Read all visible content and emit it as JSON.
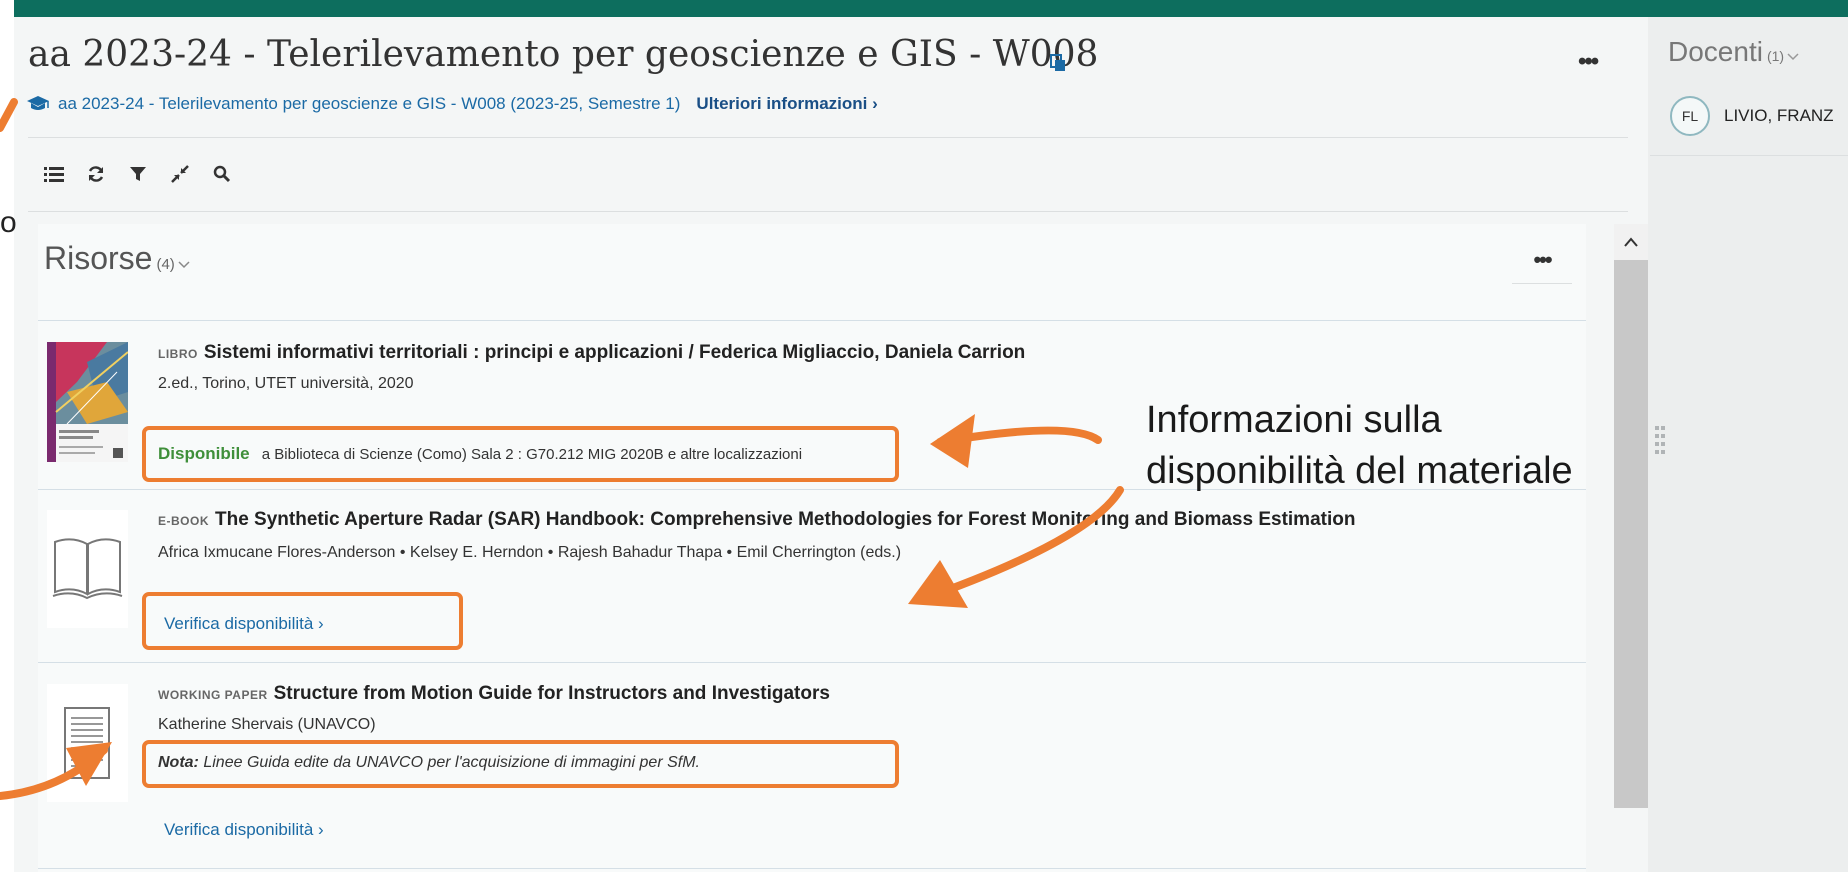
{
  "header": {
    "title": "aa 2023-24 - Telerilevamento per geoscienze e GIS - W008",
    "course_link": "aa 2023-24 - Telerilevamento per geoscienze e GIS - W008 (2023-25, Semestre 1)",
    "more_info": "Ulteriori informazioni ›",
    "more_menu": "•••"
  },
  "toolbar": {
    "icons": [
      "list-icon",
      "refresh-icon",
      "filter-icon",
      "collapse-icon",
      "search-icon"
    ]
  },
  "resources": {
    "heading": "Risorse",
    "count": "(4)",
    "more_menu": "•••",
    "items": [
      {
        "type": "LIBRO",
        "title": "Sistemi informativi territoriali : principi e applicazioni / Federica Migliaccio, Daniela Carrion",
        "subtitle": "2.ed., Torino, UTET università, 2020",
        "availability_status": "Disponibile",
        "availability_location": "a Biblioteca di Scienze (Como) Sala 2 : G70.212 MIG 2020B e altre localizzazioni"
      },
      {
        "type": "E-BOOK",
        "title": "The Synthetic Aperture Radar (SAR) Handbook: Comprehensive Methodologies for Forest Monitoring and Biomass Estimation",
        "subtitle": "Africa Ixmucane Flores-Anderson • Kelsey E. Herndon • Rajesh Bahadur Thapa • Emil Cherrington (eds.)",
        "verify": "Verifica disponibilità ›"
      },
      {
        "type": "WORKING PAPER",
        "title": "Structure from Motion Guide for Instructors and Investigators",
        "subtitle": "Katherine Shervais (UNAVCO)",
        "note_label": "Nota:",
        "note_text": "Linee Guida edite da UNAVCO per l'acquisizione di immagini per SfM.",
        "verify": "Verifica disponibilità ›"
      }
    ]
  },
  "annotation": {
    "line1": "Informazioni sulla",
    "line2": "disponibilità del materiale"
  },
  "sidebar": {
    "heading": "Docenti",
    "count": "(1)",
    "teacher_initials": "FL",
    "teacher_name": "LIVIO, FRANZ"
  },
  "colors": {
    "topbar": "#0d6e5e",
    "link": "#1b6aa5",
    "available": "#3f8f3a",
    "annotation": "#ed7d31"
  }
}
